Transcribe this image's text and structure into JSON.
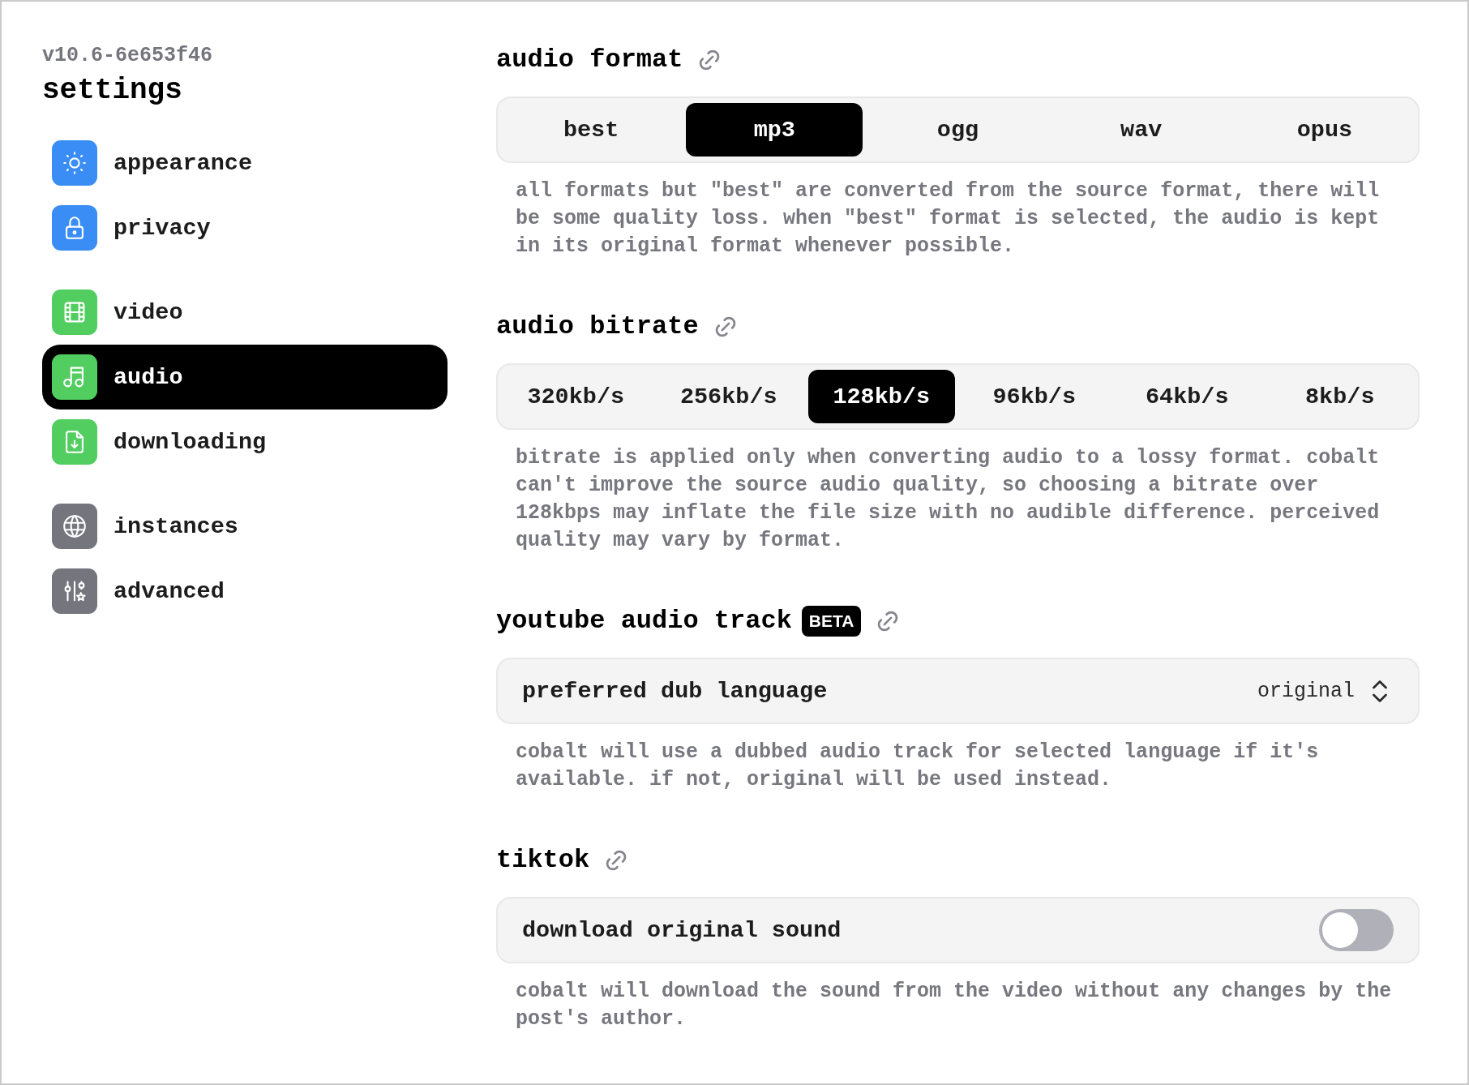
{
  "sidebar": {
    "version": "v10.6-6e653f46",
    "title": "settings",
    "groups": [
      {
        "items": [
          {
            "label": "appearance",
            "color": "#3a8df5",
            "selected": false
          },
          {
            "label": "privacy",
            "color": "#3a8df5",
            "selected": false
          }
        ]
      },
      {
        "items": [
          {
            "label": "video",
            "color": "#52cd60",
            "selected": false
          },
          {
            "label": "audio",
            "color": "#52cd60",
            "selected": true
          },
          {
            "label": "downloading",
            "color": "#52cd60",
            "selected": false
          }
        ]
      },
      {
        "items": [
          {
            "label": "instances",
            "color": "#75757e",
            "selected": false
          },
          {
            "label": "advanced",
            "color": "#75757e",
            "selected": false
          }
        ]
      }
    ]
  },
  "sections": [
    {
      "title": "audio format",
      "control": {
        "kind": "segmented",
        "options": [
          {
            "label": "best",
            "selected": false
          },
          {
            "label": "mp3",
            "selected": true
          },
          {
            "label": "ogg",
            "selected": false
          },
          {
            "label": "wav",
            "selected": false
          },
          {
            "label": "opus",
            "selected": false
          }
        ]
      },
      "description": "all formats but \"best\" are converted from the source format, there will be some quality loss. when \"best\" format is selected, the audio is kept in its original format whenever possible."
    },
    {
      "title": "audio bitrate",
      "control": {
        "kind": "segmented",
        "options": [
          {
            "label": "320kb/s",
            "selected": false
          },
          {
            "label": "256kb/s",
            "selected": false
          },
          {
            "label": "128kb/s",
            "selected": true
          },
          {
            "label": "96kb/s",
            "selected": false
          },
          {
            "label": "64kb/s",
            "selected": false
          },
          {
            "label": "8kb/s",
            "selected": false
          }
        ]
      },
      "description": "bitrate is applied only when converting audio to a lossy format. cobalt can't improve the source audio quality, so choosing a bitrate over 128kbps may inflate the file size with no audible difference. perceived quality may vary by format."
    },
    {
      "title": "youtube audio track",
      "badge": "BETA",
      "control": {
        "kind": "select",
        "label": "preferred dub language",
        "value": "original"
      },
      "description": "cobalt will use a dubbed audio track for selected language if it's available. if not, original will be used instead."
    },
    {
      "title": "tiktok",
      "control": {
        "kind": "toggle",
        "label": "download original sound",
        "on": false
      },
      "description": "cobalt will download the sound from the video without any changes by the post's author."
    }
  ]
}
